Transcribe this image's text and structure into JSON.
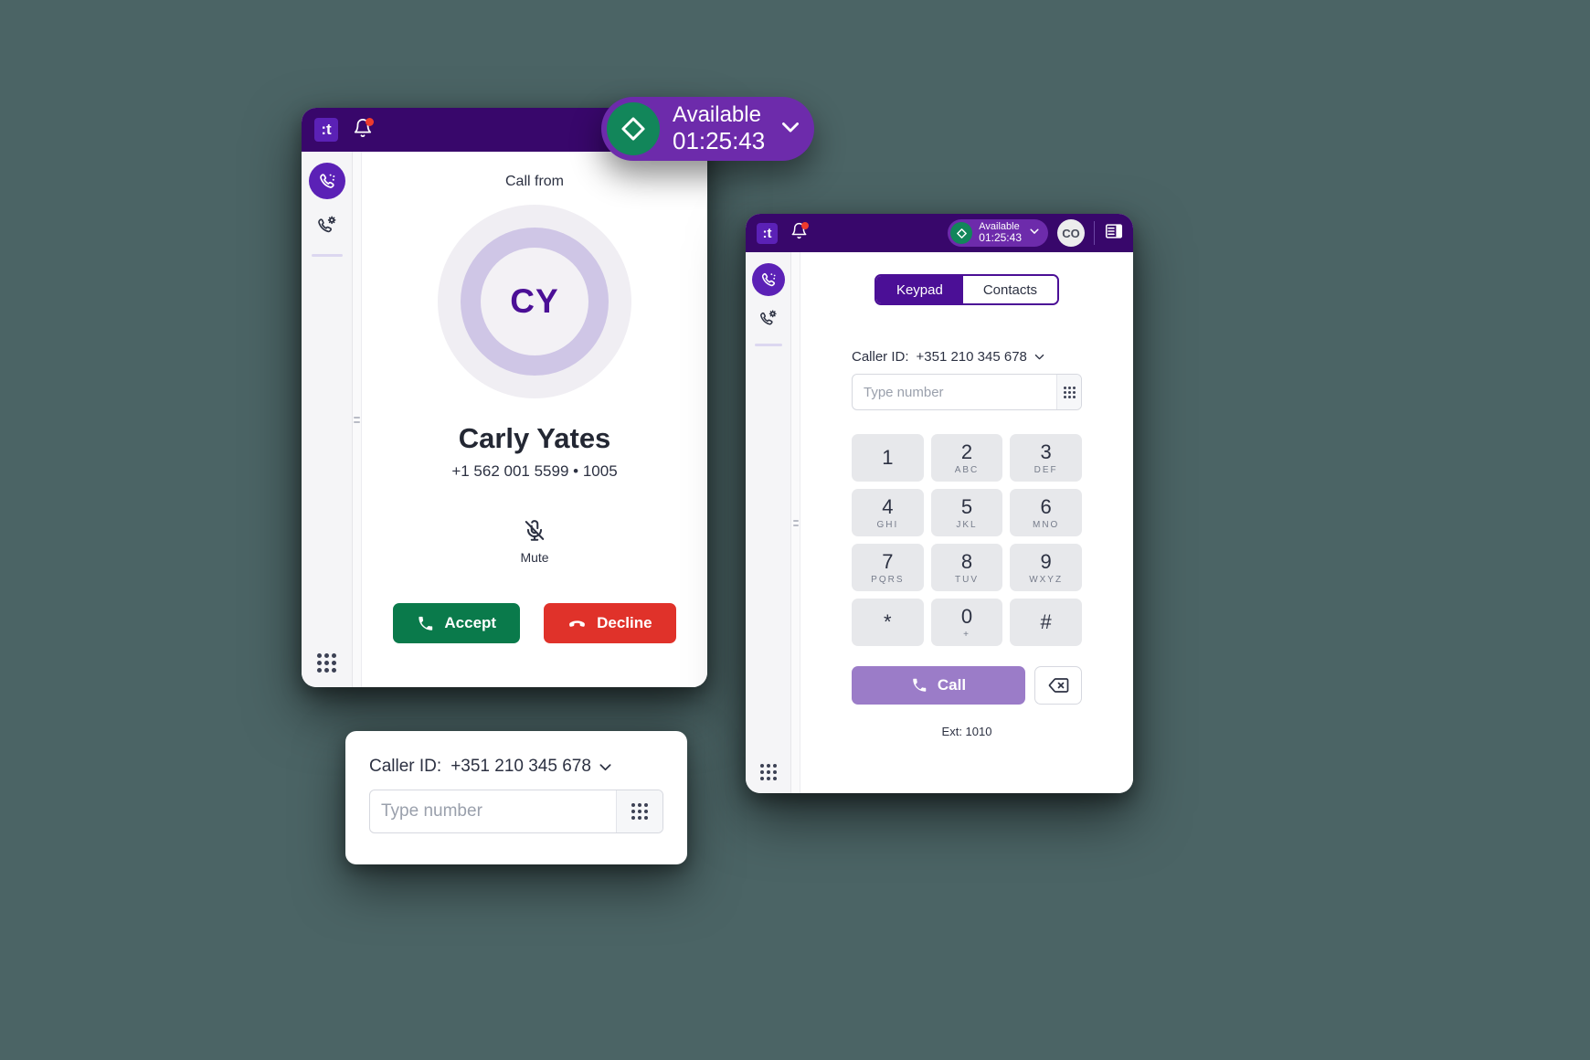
{
  "app": {
    "logo_text": ":t",
    "brand_purple": "#38076b",
    "accent_purple": "#4b0f96",
    "green": "#0a7a4b",
    "red": "#e0322a"
  },
  "incoming_call_window": {
    "header": {
      "logo": ":t",
      "notifications_icon": "bell-icon",
      "has_unread": true
    },
    "rail": {
      "items": [
        {
          "icon": "call-history-icon",
          "active": true
        },
        {
          "icon": "call-settings-icon",
          "active": false
        }
      ],
      "bottom_icon": "dialpad-icon"
    },
    "call_from_label": "Call from",
    "avatar_initials": "CY",
    "caller_name": "Carly Yates",
    "caller_number": "+1 562 001 5599 • 1005",
    "mute": {
      "label": "Mute",
      "icon": "microphone-off-icon"
    },
    "accept_button": {
      "label": "Accept",
      "icon": "phone-icon",
      "color": "#0a7a4b"
    },
    "decline_button": {
      "label": "Decline",
      "icon": "phone-hangup-icon",
      "color": "#e0322a"
    }
  },
  "status_pill": {
    "status": "Available",
    "timer": "01:25:43",
    "badge_icon": "diamond-icon",
    "chevron_icon": "chevron-down-icon",
    "badge_color": "#12865a"
  },
  "dialer_window": {
    "header": {
      "logo": ":t",
      "notifications_icon": "bell-icon",
      "has_unread": true,
      "status": "Available",
      "timer": "01:25:43",
      "user_initials": "CO",
      "panel_icon": "layout-panel-icon"
    },
    "rail": {
      "items": [
        {
          "icon": "call-history-icon",
          "active": true
        },
        {
          "icon": "call-settings-icon",
          "active": false
        }
      ],
      "bottom_icon": "dialpad-icon"
    },
    "tabs": [
      {
        "label": "Keypad",
        "active": true
      },
      {
        "label": "Contacts",
        "active": false
      }
    ],
    "caller_id": {
      "label": "Caller ID:",
      "value": "+351 210 345 678",
      "chevron_icon": "chevron-down-icon"
    },
    "number_field": {
      "value": "",
      "placeholder": "Type number",
      "toggle_icon": "dialpad-icon"
    },
    "keypad": [
      {
        "digit": "1",
        "letters": ""
      },
      {
        "digit": "2",
        "letters": "ABC"
      },
      {
        "digit": "3",
        "letters": "DEF"
      },
      {
        "digit": "4",
        "letters": "GHI"
      },
      {
        "digit": "5",
        "letters": "JKL"
      },
      {
        "digit": "6",
        "letters": "MNO"
      },
      {
        "digit": "7",
        "letters": "PQRS"
      },
      {
        "digit": "8",
        "letters": "TUV"
      },
      {
        "digit": "9",
        "letters": "WXYZ"
      },
      {
        "digit": "*",
        "letters": ""
      },
      {
        "digit": "0",
        "letters": "+"
      },
      {
        "digit": "#",
        "letters": ""
      }
    ],
    "call_button": {
      "label": "Call",
      "icon": "phone-icon",
      "color": "#9b7cc8"
    },
    "backspace_button": {
      "icon": "backspace-icon"
    },
    "extension": "Ext: 1010"
  },
  "dial_card": {
    "caller_id": {
      "label": "Caller ID:",
      "value": "+351 210 345 678",
      "chevron_icon": "chevron-down-icon"
    },
    "number_field": {
      "value": "",
      "placeholder": "Type number",
      "toggle_icon": "dialpad-icon"
    }
  }
}
